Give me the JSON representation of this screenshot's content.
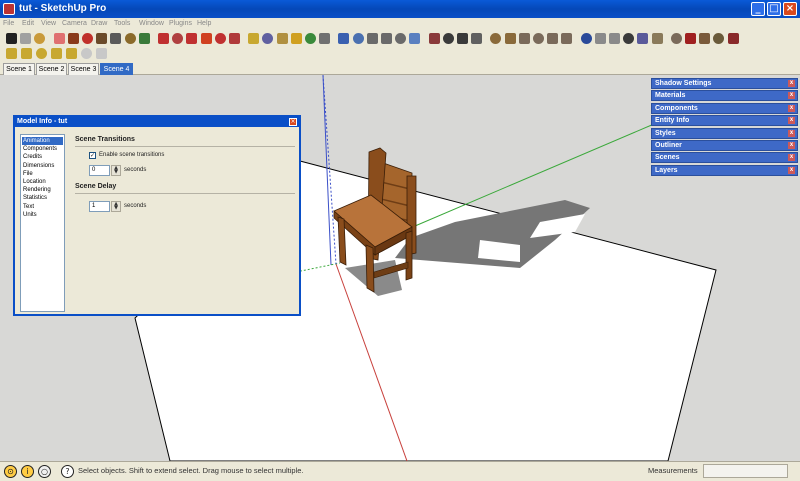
{
  "window": {
    "title": "tut - SketchUp Pro",
    "min_label": "_",
    "max_label": "□",
    "close_label": "×"
  },
  "menu": [
    {
      "label": "File",
      "name": "menu-file"
    },
    {
      "label": "Edit",
      "name": "menu-edit"
    },
    {
      "label": "View",
      "name": "menu-view"
    },
    {
      "label": "Camera",
      "name": "menu-camera"
    },
    {
      "label": "Draw",
      "name": "menu-draw"
    },
    {
      "label": "Tools",
      "name": "menu-tools"
    },
    {
      "label": "Window",
      "name": "menu-window"
    },
    {
      "label": "Plugins",
      "name": "menu-plugins"
    },
    {
      "label": "Help",
      "name": "menu-help"
    }
  ],
  "toolbar_main": [
    {
      "name": "select-tool-icon",
      "color": "#222222"
    },
    {
      "name": "make-component-icon",
      "color": "#a0a0a0"
    },
    {
      "name": "paint-bucket-icon",
      "color": "#c99a3a"
    },
    {
      "name": "eraser-icon",
      "color": "#e07070"
    },
    {
      "name": "rectangle-icon",
      "color": "#8a3a1a"
    },
    {
      "name": "line-icon",
      "color": "#c0302a"
    },
    {
      "name": "circle-icon",
      "color": "#6a4a2a"
    },
    {
      "name": "arc-icon",
      "color": "#5a5a5a"
    },
    {
      "name": "polygon-icon",
      "color": "#8b6a2a"
    },
    {
      "name": "freehand-icon",
      "color": "#3a7a3a"
    },
    {
      "name": "move-icon",
      "color": "#c03030"
    },
    {
      "name": "push-pull-icon",
      "color": "#b04040"
    },
    {
      "name": "rotate-icon",
      "color": "#c03030"
    },
    {
      "name": "follow-me-icon",
      "color": "#d04020"
    },
    {
      "name": "scale-icon",
      "color": "#c03030"
    },
    {
      "name": "offset-icon",
      "color": "#b03a3a"
    },
    {
      "name": "tape-measure-icon",
      "color": "#c8a830"
    },
    {
      "name": "dimension-icon",
      "color": "#6060a0"
    },
    {
      "name": "protractor-icon",
      "color": "#b09040"
    },
    {
      "name": "text-icon",
      "color": "#d0a020"
    },
    {
      "name": "axes-icon",
      "color": "#3a8a3a"
    },
    {
      "name": "3d-text-icon",
      "color": "#707070"
    },
    {
      "name": "orbit-icon",
      "color": "#3a60b0"
    },
    {
      "name": "pan-icon",
      "color": "#4a70b0"
    },
    {
      "name": "zoom-icon",
      "color": "#6a6a6a"
    },
    {
      "name": "zoom-window-icon",
      "color": "#6a6a6a"
    },
    {
      "name": "zoom-extents-icon",
      "color": "#6a6a6a"
    },
    {
      "name": "previous-view-icon",
      "color": "#5a80c0"
    },
    {
      "name": "position-camera-icon",
      "color": "#8a3a3a"
    },
    {
      "name": "walk-icon",
      "color": "#3a3a3a"
    },
    {
      "name": "look-around-icon",
      "color": "#3a3a3a"
    },
    {
      "name": "section-plane-icon",
      "color": "#606060"
    },
    {
      "name": "iso-view-icon",
      "color": "#8a6a3a"
    },
    {
      "name": "top-view-icon",
      "color": "#8a6a3a"
    },
    {
      "name": "front-view-icon",
      "color": "#7a6a5a"
    },
    {
      "name": "right-view-icon",
      "color": "#7a6a5a"
    },
    {
      "name": "back-view-icon",
      "color": "#7a6a5a"
    },
    {
      "name": "left-view-icon",
      "color": "#7a6a5a"
    },
    {
      "name": "xray-icon",
      "color": "#2a4a9a"
    },
    {
      "name": "wireframe-icon",
      "color": "#8a8a8a"
    },
    {
      "name": "hidden-line-icon",
      "color": "#8a8a8a"
    },
    {
      "name": "shaded-icon",
      "color": "#3a3a3a"
    },
    {
      "name": "shaded-textures-icon",
      "color": "#5a5a9a"
    },
    {
      "name": "monochrome-icon",
      "color": "#8a7a5a"
    },
    {
      "name": "google-earth-icon",
      "color": "#7a6a5a"
    },
    {
      "name": "toggle-terrain-icon",
      "color": "#a02020"
    },
    {
      "name": "place-model-icon",
      "color": "#7a5a3a"
    },
    {
      "name": "get-models-icon",
      "color": "#6a5a3a"
    },
    {
      "name": "share-model-icon",
      "color": "#8a2a2a"
    }
  ],
  "toolbar_second": [
    {
      "name": "sandbox-from-contours-icon",
      "color": "#c8a830"
    },
    {
      "name": "sandbox-from-scratch-icon",
      "color": "#c8a830"
    },
    {
      "name": "smoove-icon",
      "color": "#c8a830"
    },
    {
      "name": "stamp-icon",
      "color": "#c8a830"
    },
    {
      "name": "drape-icon",
      "color": "#c8a830"
    },
    {
      "name": "add-detail-icon",
      "color": "#c8c8c8"
    },
    {
      "name": "flip-edge-icon",
      "color": "#c8c8c8"
    }
  ],
  "scenes": [
    {
      "label": "Scene 1",
      "active": false
    },
    {
      "label": "Scene 2",
      "active": false
    },
    {
      "label": "Scene 3",
      "active": false
    },
    {
      "label": "Scene 4",
      "active": true
    }
  ],
  "dialog": {
    "title": "Model Info - tut",
    "close_label": "×",
    "list": [
      "Animation",
      "Components",
      "Credits",
      "Dimensions",
      "File",
      "Location",
      "Rendering",
      "Statistics",
      "Text",
      "Units"
    ],
    "selected": "Animation",
    "transitions_heading": "Scene Transitions",
    "enable_label": "Enable scene transitions",
    "enable_checked": true,
    "check_mark": "✓",
    "transition_value": "0",
    "transition_unit": "seconds",
    "delay_heading": "Scene Delay",
    "delay_value": "1",
    "delay_unit": "seconds",
    "spin_up": "▲",
    "spin_down": "▼"
  },
  "trays": [
    {
      "label": "Shadow Settings",
      "name": "tray-shadow-settings"
    },
    {
      "label": "Materials",
      "name": "tray-materials"
    },
    {
      "label": "Components",
      "name": "tray-components"
    },
    {
      "label": "Entity Info",
      "name": "tray-entity-info"
    },
    {
      "label": "Styles",
      "name": "tray-styles"
    },
    {
      "label": "Outliner",
      "name": "tray-outliner"
    },
    {
      "label": "Scenes",
      "name": "tray-scenes"
    },
    {
      "label": "Layers",
      "name": "tray-layers"
    }
  ],
  "tray_close_label": "x",
  "status": {
    "icons": [
      {
        "name": "geo-location-icon",
        "glyph": "⊙"
      },
      {
        "name": "credits-icon",
        "glyph": "i"
      },
      {
        "name": "user-info-icon",
        "glyph": "○"
      },
      {
        "name": "help-icon",
        "glyph": "?"
      }
    ],
    "text": "Select objects. Shift to extend select. Drag mouse to select multiple.",
    "measurements_label": "Measurements",
    "measurements_value": ""
  },
  "colors": {
    "title_bar": "#0a5ad8",
    "tray_header": "#3e69c7",
    "selection": "#316ac5",
    "wood": "#9b5a24",
    "ground": "#ffffff",
    "sky_ground": "#d8d8d6"
  }
}
